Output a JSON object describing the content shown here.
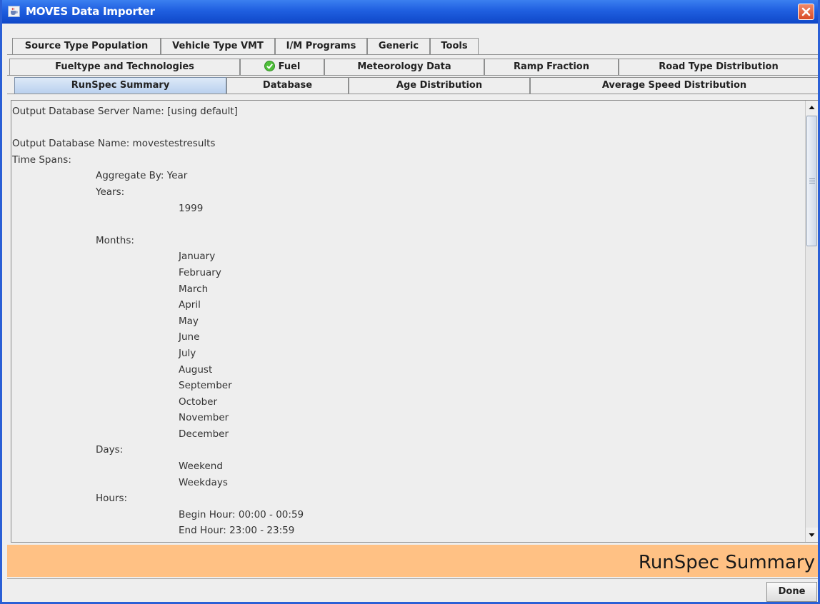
{
  "window": {
    "title": "MOVES Data Importer",
    "app_icon": "java-cup-icon",
    "close_icon": "close-icon"
  },
  "tabs": {
    "row1": [
      "Source Type Population",
      "Vehicle Type VMT",
      "I/M Programs",
      "Generic",
      "Tools"
    ],
    "row2": [
      "Fueltype and Technologies",
      "Fuel",
      "Meteorology Data",
      "Ramp Fraction",
      "Road Type Distribution"
    ],
    "row3": [
      "RunSpec Summary",
      "Database",
      "Age Distribution",
      "Average Speed Distribution"
    ],
    "selected": "RunSpec Summary",
    "fuel_status_icon": "green-check-icon"
  },
  "summary": {
    "server_line": "Output Database Server Name: [using default]",
    "db_line": "Output Database Name: movestestresults",
    "time_spans_label": "Time Spans:",
    "aggregate_by": "Aggregate By: Year",
    "years_label": "Years:",
    "years": [
      "1999"
    ],
    "months_label": "Months:",
    "months": [
      "January",
      "February",
      "March",
      "April",
      "May",
      "June",
      "July",
      "August",
      "September",
      "October",
      "November",
      "December"
    ],
    "days_label": "Days:",
    "days": [
      "Weekend",
      "Weekdays"
    ],
    "hours_label": "Hours:",
    "begin_hour": "Begin Hour: 00:00 - 00:59",
    "end_hour": "End Hour: 23:00 - 23:59"
  },
  "banner": {
    "title": "RunSpec Summary"
  },
  "footer": {
    "done_label": "Done"
  },
  "colors": {
    "banner_bg": "#ffc184",
    "title_bar": "#1f5fe0",
    "selected_tab": "#b8cfee"
  }
}
